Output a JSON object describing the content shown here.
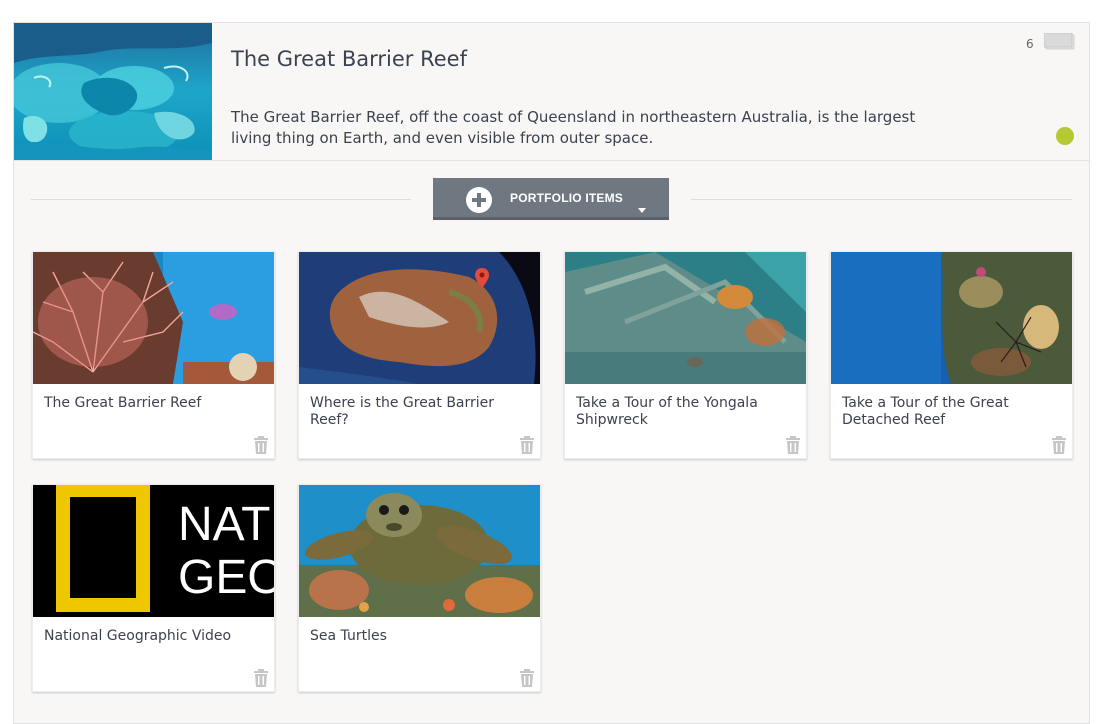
{
  "header": {
    "title": "The Great Barrier Reef",
    "description": "The Great Barrier Reef, off the coast of Queensland in northeastern Australia, is the largest living thing on Earth, and even visible from outer space.",
    "count": "6",
    "status_color": "#b5c932",
    "thumbnail_icon": "reef-aerial-image"
  },
  "portfolio_button": {
    "label": "PORTFOLIO ITEMS",
    "icon": "plus-icon",
    "caret": "chevron-down-icon"
  },
  "items": [
    {
      "title": "The Great Barrier Reef",
      "image": "coral-fan-image"
    },
    {
      "title": "Where is the Great Barrier Reef?",
      "image": "australia-map-image"
    },
    {
      "title": "Take a Tour of the Yongala Shipwreck",
      "image": "shipwreck-image"
    },
    {
      "title": "Take a Tour of the Great Detached Reef",
      "image": "detached-reef-image"
    },
    {
      "title": "National Geographic Video",
      "image": "national-geographic-logo"
    },
    {
      "title": "Sea Turtles",
      "image": "sea-turtle-image"
    }
  ],
  "colors": {
    "accent_button": "#6f7880",
    "status": "#b5c932",
    "trash_icon": "#c4c6c8"
  }
}
